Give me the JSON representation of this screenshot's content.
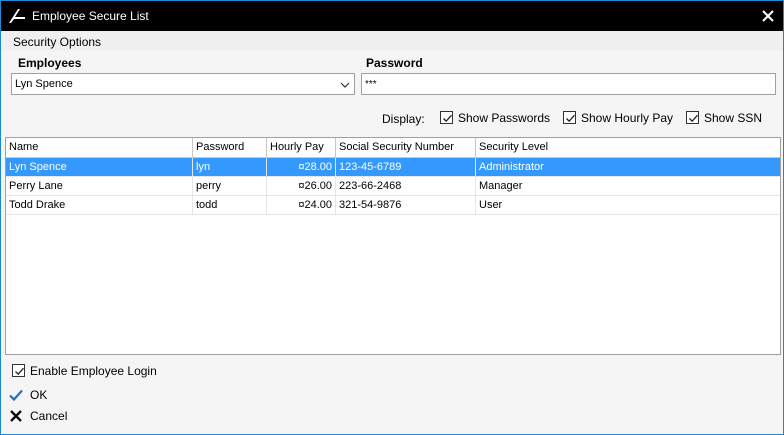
{
  "window": {
    "title": "Employee Secure List"
  },
  "menu": {
    "security_options": "Security Options"
  },
  "form": {
    "employees_label": "Employees",
    "employee_selected": "Lyn Spence",
    "password_label": "Password",
    "password_value": "***"
  },
  "display": {
    "label": "Display:",
    "show_passwords": {
      "label": "Show Passwords",
      "checked": true
    },
    "show_hourly_pay": {
      "label": "Show Hourly Pay",
      "checked": true
    },
    "show_ssn": {
      "label": "Show SSN",
      "checked": true
    }
  },
  "table": {
    "columns": [
      "Name",
      "Password",
      "Hourly Pay",
      "Social Security Number",
      "Security Level"
    ],
    "rows": [
      [
        "Lyn Spence",
        "lyn",
        "¤28.00",
        "123-45-6789",
        "Administrator"
      ],
      [
        "Perry Lane",
        "perry",
        "¤26.00",
        "223-66-2468",
        "Manager"
      ],
      [
        "Todd Drake",
        "todd",
        "¤24.00",
        "321-54-9876",
        "User"
      ]
    ],
    "selected_row": 0
  },
  "footer": {
    "enable_login": {
      "label": "Enable Employee Login",
      "checked": true
    },
    "ok_label": "OK",
    "cancel_label": "Cancel"
  },
  "colors": {
    "titlebar": "#000000",
    "selection": "#3399ff",
    "ok_check": "#1e73be",
    "window_border": "#1a8ad6"
  }
}
